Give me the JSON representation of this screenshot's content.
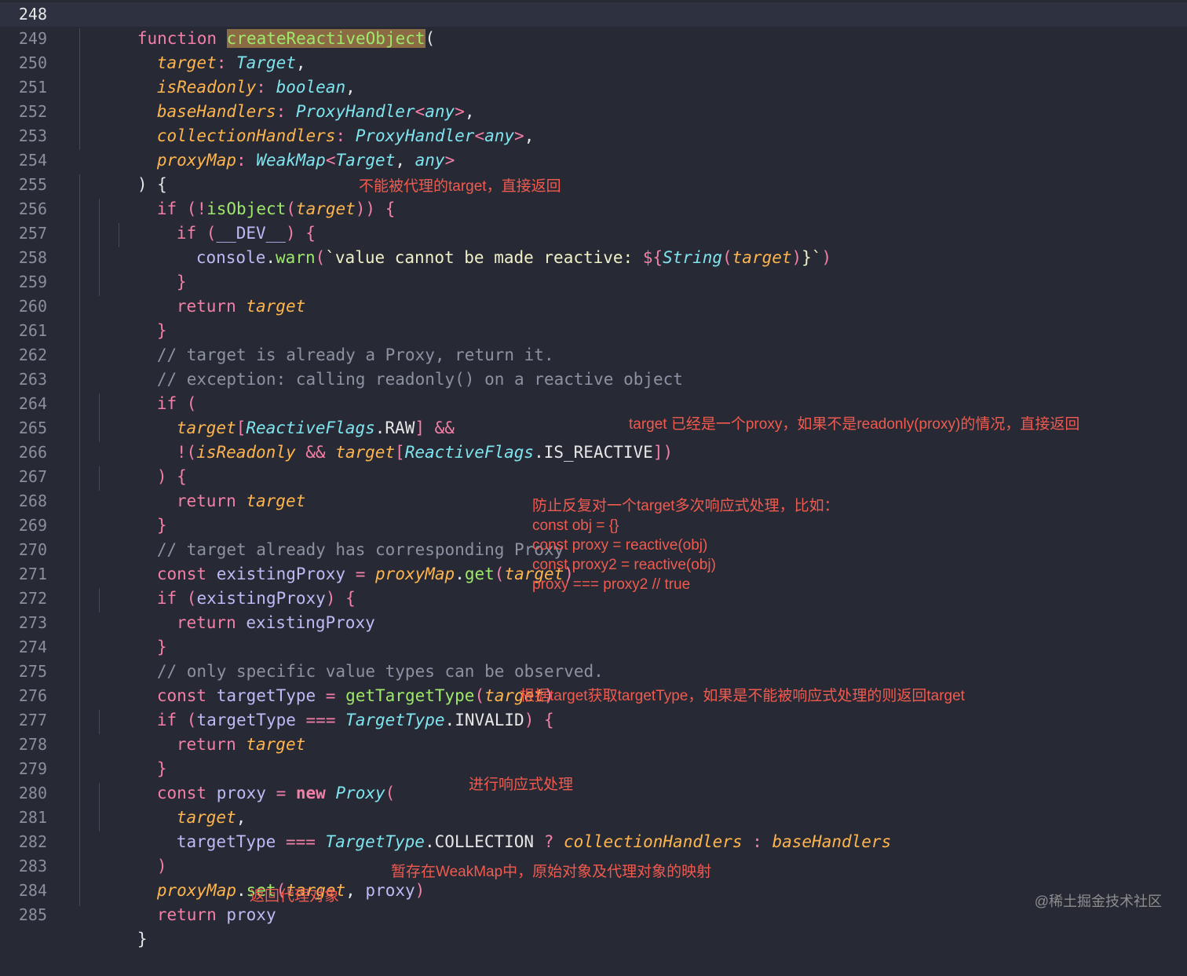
{
  "editor": {
    "current_line": "248",
    "line_numbers": [
      "248",
      "249",
      "250",
      "251",
      "252",
      "253",
      "254",
      "255",
      "256",
      "257",
      "258",
      "259",
      "260",
      "261",
      "262",
      "263",
      "264",
      "265",
      "266",
      "267",
      "268",
      "269",
      "270",
      "271",
      "272",
      "273",
      "274",
      "275",
      "276",
      "277",
      "278",
      "279",
      "280",
      "281",
      "282",
      "283",
      "284",
      "285"
    ],
    "code": {
      "l248": {
        "kw": "function ",
        "fn": "createReactiveObject",
        "p": "("
      },
      "l249": {
        "name": "target",
        "colon": ": ",
        "type": "Target",
        "end": ","
      },
      "l250": {
        "name": "isReadonly",
        "colon": ": ",
        "type": "boolean",
        "end": ","
      },
      "l251": {
        "name": "baseHandlers",
        "colon": ": ",
        "type": "ProxyHandler",
        "lt": "<",
        "arg": "any",
        "gt": ">",
        "end": ","
      },
      "l252": {
        "name": "collectionHandlers",
        "colon": ": ",
        "type": "ProxyHandler",
        "lt": "<",
        "arg": "any",
        "gt": ">",
        "end": ","
      },
      "l253": {
        "name": "proxyMap",
        "colon": ": ",
        "type": "WeakMap",
        "lt": "<",
        "arg1": "Target",
        "comma": ", ",
        "arg2": "any",
        "gt": ">"
      },
      "l254": {
        "text": ") {"
      },
      "l255": {
        "kw": "if ",
        "p1": "(",
        "bang": "!",
        "fn": "isObject",
        "p2": "(",
        "arg": "target",
        "p3": ")) {"
      },
      "l256": {
        "kw": "if ",
        "p1": "(",
        "ident": "__DEV__",
        "p2": ") {"
      },
      "l257": {
        "obj": "console",
        "dot": ".",
        "fn": "warn",
        "p1": "(",
        "str": "`value cannot be made reactive: ",
        "interp": "${",
        "type": "String",
        "p2": "(",
        "arg": "target",
        "p3": ")",
        "close": "}`",
        "p4": ")"
      },
      "l258": {
        "text": "}"
      },
      "l259": {
        "kw": "return ",
        "arg": "target"
      },
      "l260": {
        "text": "}"
      },
      "l261": {
        "text": "// target is already a Proxy, return it."
      },
      "l262": {
        "text": "// exception: calling readonly() on a reactive object"
      },
      "l263": {
        "kw": "if ",
        "p": "("
      },
      "l264": {
        "arg": "target",
        "b1": "[",
        "type": "ReactiveFlags",
        "dot": ".",
        "prop": "RAW",
        "b2": "] ",
        "op": "&&"
      },
      "l265": {
        "bang": "!",
        "p1": "(",
        "arg1": "isReadonly",
        "op": " && ",
        "arg2": "target",
        "b1": "[",
        "type": "ReactiveFlags",
        "dot": ".",
        "prop": "IS_REACTIVE",
        "b2": "])"
      },
      "l266": {
        "text": ") {"
      },
      "l267": {
        "kw": "return ",
        "arg": "target"
      },
      "l268": {
        "text": "}"
      },
      "l269": {
        "text": "// target already has corresponding Proxy"
      },
      "l270": {
        "kw": "const ",
        "name": "existingProxy",
        "op": " = ",
        "obj": "proxyMap",
        "dot": ".",
        "fn": "get",
        "p1": "(",
        "arg": "target",
        "p2": ")"
      },
      "l271": {
        "kw": "if ",
        "p1": "(",
        "name": "existingProxy",
        "p2": ") {"
      },
      "l272": {
        "kw": "return ",
        "name": "existingProxy"
      },
      "l273": {
        "text": "}"
      },
      "l274": {
        "text": "// only specific value types can be observed."
      },
      "l275": {
        "kw": "const ",
        "name": "targetType",
        "op": " = ",
        "fn": "getTargetType",
        "p1": "(",
        "arg": "target",
        "p2": ")"
      },
      "l276": {
        "kw": "if ",
        "p1": "(",
        "name": "targetType",
        "op": " === ",
        "type": "TargetType",
        "dot": ".",
        "prop": "INVALID",
        "p2": ") {"
      },
      "l277": {
        "kw": "return ",
        "arg": "target"
      },
      "l278": {
        "text": "}"
      },
      "l279": {
        "kw": "const ",
        "name": "proxy",
        "op": " = ",
        "new": "new ",
        "type": "Proxy",
        "p": "("
      },
      "l280": {
        "arg": "target",
        "end": ","
      },
      "l281": {
        "name": "targetType",
        "op": " === ",
        "type": "TargetType",
        "dot": ".",
        "prop": "COLLECTION",
        "q": " ? ",
        "arg1": "collectionHandlers",
        "c": " : ",
        "arg2": "baseHandlers"
      },
      "l282": {
        "text": ")"
      },
      "l283": {
        "obj": "proxyMap",
        "dot": ".",
        "fn": "set",
        "p1": "(",
        "arg": "target",
        "comma": ", ",
        "name": "proxy",
        "p2": ")"
      },
      "l284": {
        "kw": "return ",
        "name": "proxy"
      },
      "l285": {
        "text": "}"
      }
    }
  },
  "notes": {
    "n255": "不能被代理的target，直接返回",
    "n265": "target 已经是一个proxy，如果不是readonly(proxy)的情况，直接返回",
    "n268": [
      "防止反复对一个target多次响应式处理，比如：",
      "const obj = {}",
      "const proxy = reactive(obj)",
      "const proxy2 = reactive(obj)",
      "proxy === proxy2 // true"
    ],
    "n276": "根据target获取targetType，如果是不能被响应式处理的则返回target",
    "n280": "进行响应式处理",
    "n283": "暂存在WeakMap中，原始对象及代理对象的映射",
    "n284": "返回代理对象"
  },
  "watermark": "@稀土掘金技术社区"
}
